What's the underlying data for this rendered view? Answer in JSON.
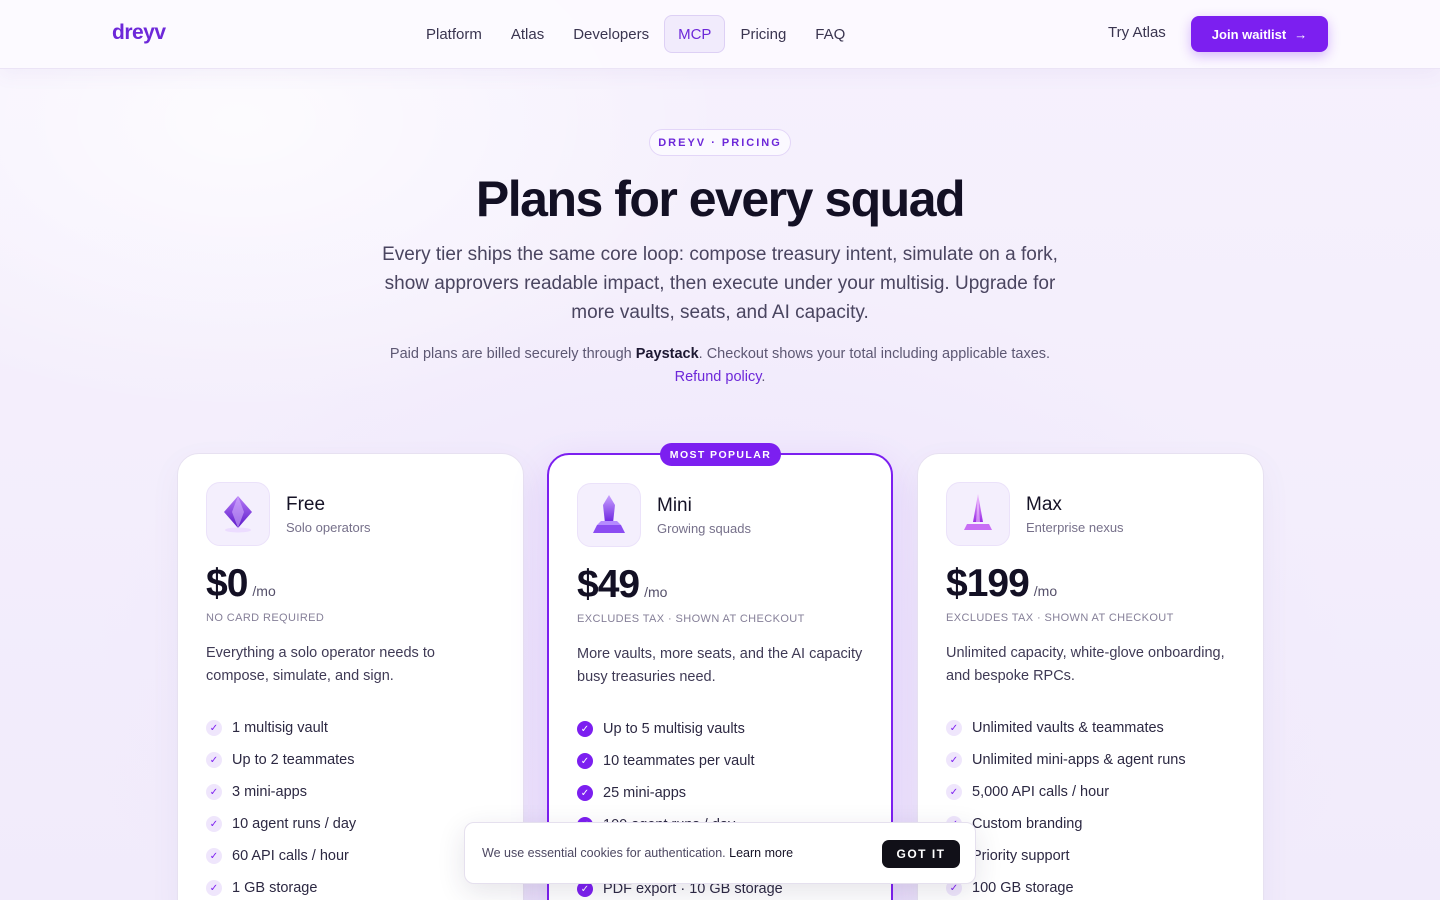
{
  "brand": {
    "name": "dreyv",
    "accent": "#7c1ff0"
  },
  "nav": {
    "links": [
      "Platform",
      "Atlas",
      "Developers",
      "MCP",
      "Pricing",
      "FAQ"
    ],
    "active": "MCP",
    "try_atlas": "Try Atlas",
    "join_label": "Join waitlist",
    "join_icon": "arrow-right-icon"
  },
  "hero": {
    "eyebrow": "DREYV · PRICING",
    "title": "Plans for every squad",
    "subtitle": "Every tier ships the same core loop: compose treasury intent, simulate on a fork, show approvers readable impact, then execute under your multisig. Upgrade for more vaults, seats, and AI capacity.",
    "billing_prefix": "Paid plans are billed securely through ",
    "billing_brand": "Paystack",
    "billing_suffix": ". Checkout shows your total including applicable taxes.",
    "refund_link": "Refund policy",
    "refund_suffix": "."
  },
  "plans": [
    {
      "name": "Free",
      "tagline": "Solo operators",
      "price": "$0",
      "unit": "/mo",
      "note": "NO CARD REQUIRED",
      "description": "Everything a solo operator needs to compose, simulate, and sign.",
      "icon": "crystal-gem-icon",
      "features": [
        "1 multisig vault",
        "Up to 2 teammates",
        "3 mini-apps",
        "10 agent runs / day",
        "60 API calls / hour",
        "1 GB storage"
      ]
    },
    {
      "name": "Mini",
      "tagline": "Growing squads",
      "price": "$49",
      "unit": "/mo",
      "note": "EXCLUDES TAX · SHOWN AT CHECKOUT",
      "description": "More vaults, more seats, and the AI capacity busy treasuries need.",
      "icon": "crystal-tower-icon",
      "badge": "MOST POPULAR",
      "features": [
        "Up to 5 multisig vaults",
        "10 teammates per vault",
        "25 mini-apps",
        "100 agent runs / day",
        "",
        "PDF export · 10 GB storage"
      ]
    },
    {
      "name": "Max",
      "tagline": "Enterprise nexus",
      "price": "$199",
      "unit": "/mo",
      "note": "EXCLUDES TAX · SHOWN AT CHECKOUT",
      "description": "Unlimited capacity, white-glove onboarding, and bespoke RPCs.",
      "icon": "crystal-spire-icon",
      "features": [
        "Unlimited vaults & teammates",
        "Unlimited mini-apps & agent runs",
        "5,000 API calls / hour",
        "Custom branding",
        "Priority support",
        "100 GB storage"
      ]
    }
  ],
  "cookie": {
    "text": "We use essential cookies for authentication.",
    "learn_more": "Learn more",
    "button": "GOT IT"
  }
}
